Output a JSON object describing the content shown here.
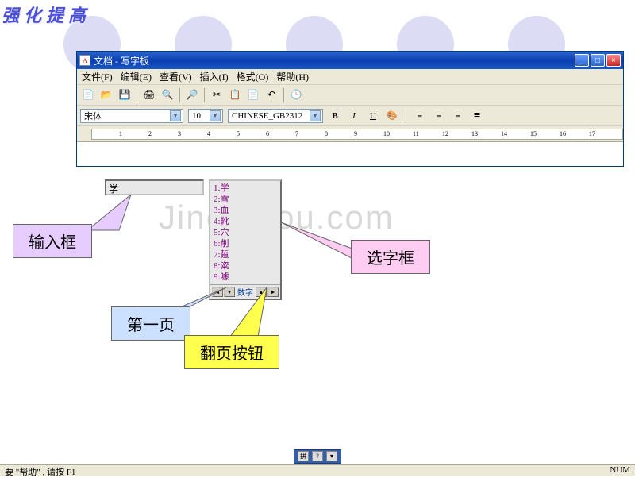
{
  "decor_title": "强化提高",
  "watermark": "Jinchutou.com",
  "window": {
    "title": "文档 - 写字板",
    "menus": [
      "文件(F)",
      "编辑(E)",
      "查看(V)",
      "插入(I)",
      "格式(O)",
      "帮助(H)"
    ],
    "font_name": "宋体",
    "font_size": "10",
    "charset": "CHINESE_GB2312",
    "btn_bold": "B",
    "btn_italic": "I",
    "btn_underline": "U"
  },
  "ruler_marks": [
    "1",
    "2",
    "3",
    "4",
    "5",
    "6",
    "7",
    "8",
    "9",
    "10",
    "11",
    "12",
    "13",
    "14",
    "15",
    "16",
    "17"
  ],
  "ime": {
    "input_text": "学",
    "candidates": [
      "1:学",
      "2:雪",
      "3:血",
      "4:靴",
      "5:穴",
      "6:削",
      "7:踅",
      "8:粢",
      "9:噱"
    ],
    "mode_label": "数字"
  },
  "callouts": {
    "input_box": "输入框",
    "select_box": "选字框",
    "first_page": "第一页",
    "page_button": "翻页按钮"
  },
  "statusbar": {
    "help": "要 \"帮助\" , 请按 F1",
    "num": "NUM"
  }
}
